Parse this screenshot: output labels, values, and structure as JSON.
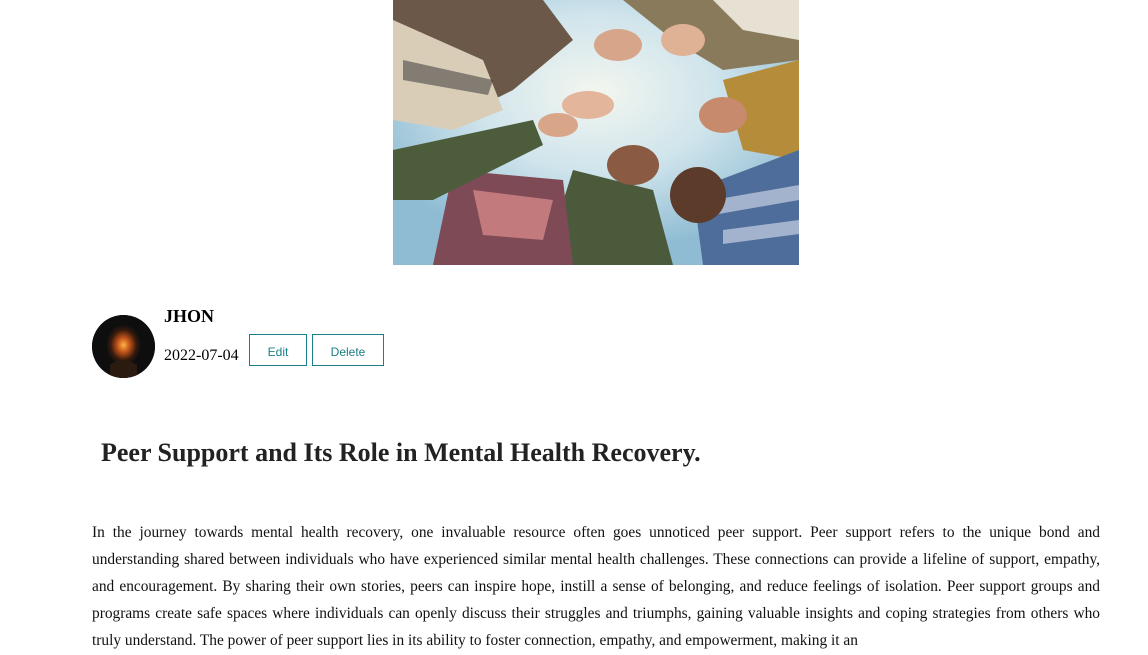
{
  "post": {
    "author": "JHON",
    "date": "2022-07-04",
    "title": "Peer Support and Its Role in Mental Health Recovery.",
    "body": "In the journey towards mental health recovery, one invaluable resource often goes unnoticed peer support. Peer support refers to the unique bond and understanding shared between individuals who have experienced similar mental health challenges. These connections can provide a lifeline of support, empathy, and encouragement. By sharing their own stories, peers can inspire hope, instill a sense of belonging, and reduce feelings of isolation. Peer support groups and programs create safe spaces where individuals can openly discuss their struggles and triumphs, gaining valuable insights and coping strategies from others who truly understand. The power of peer support lies in its ability to foster connection, empathy, and empowerment, making it an"
  },
  "actions": {
    "edit_label": "Edit",
    "delete_label": "Delete"
  },
  "colors": {
    "button_accent": "#1a7f86",
    "title_text": "#222222"
  },
  "icons": {
    "hero": "people-holding-hands-photo",
    "avatar": "author-avatar-image"
  }
}
